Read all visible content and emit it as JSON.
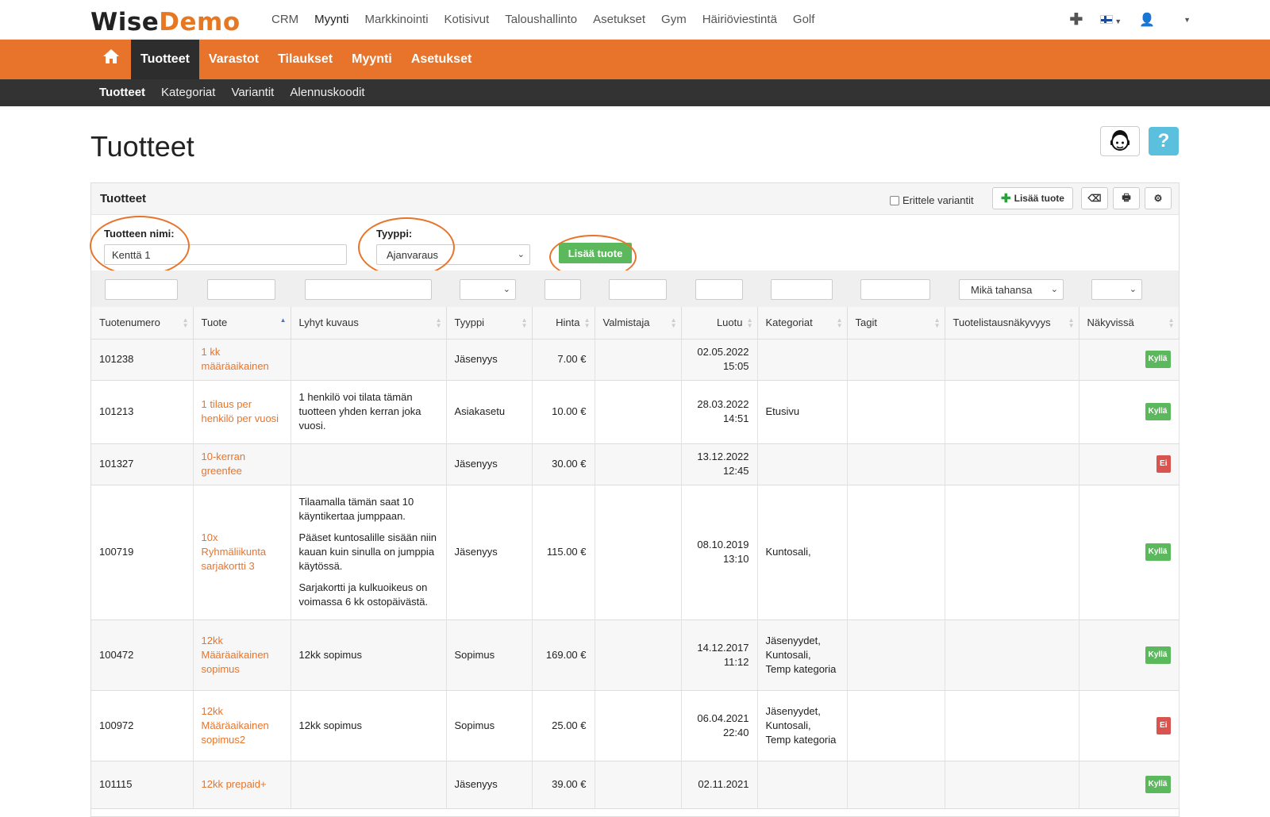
{
  "logo": {
    "part1": "Wise",
    "part2": "Demo"
  },
  "topnav": [
    "CRM",
    "Myynti",
    "Markkinointi",
    "Kotisivut",
    "Taloushallinto",
    "Asetukset",
    "Gym",
    "Häiriöviestintä",
    "Golf"
  ],
  "topnav_active": "Myynti",
  "orangenav": {
    "home_icon": "home-icon",
    "items": [
      "Tuotteet",
      "Varastot",
      "Tilaukset",
      "Myynti",
      "Asetukset"
    ],
    "active": "Tuotteet"
  },
  "subnav": {
    "items": [
      "Tuotteet",
      "Kategoriat",
      "Variantit",
      "Alennuskoodit"
    ],
    "active": "Tuotteet"
  },
  "page": {
    "title": "Tuotteet",
    "help_label": "?"
  },
  "panel": {
    "title": "Tuotteet",
    "variant_label": "Erittele variantit",
    "add_label": "Lisää tuote"
  },
  "addform": {
    "name_label": "Tuotteen nimi:",
    "name_value": "Kenttä 1",
    "type_label": "Tyyppi:",
    "type_value": "Ajanvaraus",
    "button_label": "Lisää tuote"
  },
  "filters": {
    "visibility_value": "Mikä tahansa"
  },
  "columns": [
    "Tuotenumero",
    "Tuote",
    "Lyhyt kuvaus",
    "Tyyppi",
    "Hinta",
    "Valmistaja",
    "Luotu",
    "Kategoriat",
    "Tagit",
    "Tuotelistausnäkyvyys",
    "Näkyvissä"
  ],
  "rows": [
    {
      "id": "101238",
      "name": "1 kk määräaikainen",
      "desc": [],
      "type": "Jäsenyys",
      "price": "7.00 €",
      "maker": "",
      "created": [
        "02.05.2022",
        "15:05"
      ],
      "cats": "",
      "tags": "",
      "listing": "",
      "visible": "Kyllä",
      "visible_ok": true
    },
    {
      "id": "101213",
      "name": "1 tilaus per henkilö per vuosi",
      "desc": [
        "1 henkilö voi tilata tämän tuotteen yhden kerran joka vuosi."
      ],
      "type": "Asiakasetu",
      "price": "10.00 €",
      "maker": "",
      "created": [
        "28.03.2022",
        "14:51"
      ],
      "cats": "Etusivu",
      "tags": "",
      "listing": "",
      "visible": "Kyllä",
      "visible_ok": true
    },
    {
      "id": "101327",
      "name": "10-kerran greenfee",
      "desc": [],
      "type": "Jäsenyys",
      "price": "30.00 €",
      "maker": "",
      "created": [
        "13.12.2022",
        "12:45"
      ],
      "cats": "",
      "tags": "",
      "listing": "",
      "visible": "Ei",
      "visible_ok": false
    },
    {
      "id": "100719",
      "name": "10x Ryhmäliikunta sarjakortti 3",
      "desc": [
        "Tilaamalla tämän saat 10 käyntikertaa jumppaan.",
        "Pääset kuntosalille sisään niin kauan kuin sinulla on jumppia käytössä.",
        "Sarjakortti ja kulkuoikeus on voimassa 6 kk ostopäivästä."
      ],
      "type": "Jäsenyys",
      "price": "115.00 €",
      "maker": "",
      "created": [
        "08.10.2019",
        "13:10"
      ],
      "cats": "Kuntosali,",
      "tags": "",
      "listing": "",
      "visible": "Kyllä",
      "visible_ok": true
    },
    {
      "id": "100472",
      "name": "12kk Määräaikainen sopimus",
      "desc": [
        "12kk sopimus"
      ],
      "type": "Sopimus",
      "price": "169.00 €",
      "maker": "",
      "created": [
        "14.12.2017",
        "11:12"
      ],
      "cats": "Jäsenyydet, Kuntosali, Temp kategoria",
      "tags": "",
      "listing": "",
      "visible": "Kyllä",
      "visible_ok": true
    },
    {
      "id": "100972",
      "name": "12kk Määräaikainen sopimus2",
      "desc": [
        "12kk sopimus"
      ],
      "type": "Sopimus",
      "price": "25.00 €",
      "maker": "",
      "created": [
        "06.04.2021",
        "22:40"
      ],
      "cats": "Jäsenyydet, Kuntosali, Temp kategoria",
      "tags": "",
      "listing": "",
      "visible": "Ei",
      "visible_ok": false
    },
    {
      "id": "101115",
      "name": "12kk prepaid+",
      "desc": [],
      "type": "Jäsenyys",
      "price": "39.00 €",
      "maker": "",
      "created": [
        "02.11.2021",
        ""
      ],
      "cats": "",
      "tags": "",
      "listing": "",
      "visible": "Kyllä",
      "visible_ok": true
    }
  ],
  "colors": {
    "accent": "#e8742b",
    "dark": "#333333",
    "green": "#5cb85c",
    "red": "#d9534f",
    "help": "#5bc0de"
  }
}
